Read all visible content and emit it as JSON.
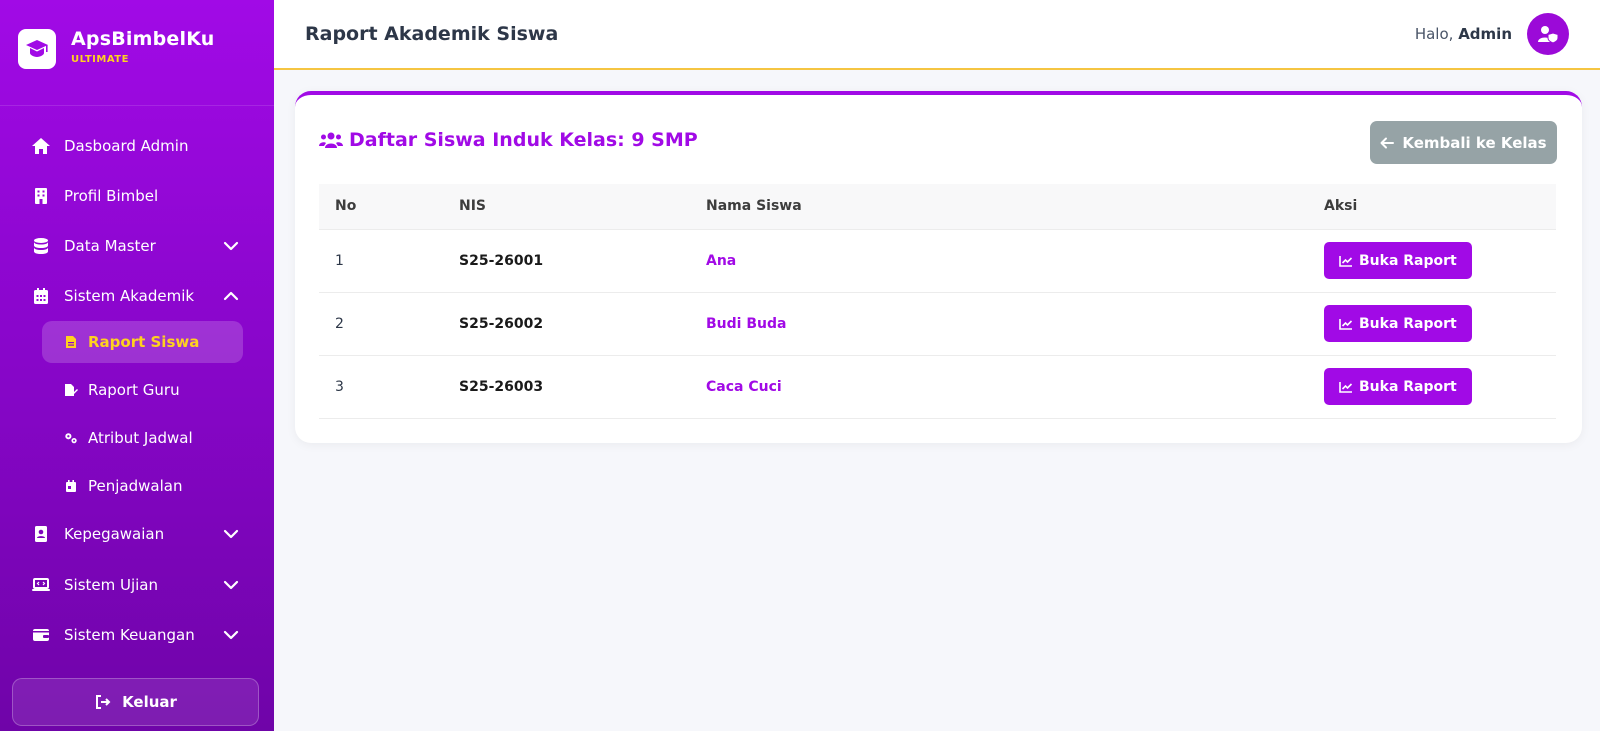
{
  "brand": {
    "name": "ApsBimbelKu",
    "subtitle": "ULTIMATE"
  },
  "sidebar": {
    "items": [
      {
        "label": "Dasboard Admin",
        "icon": "home-icon"
      },
      {
        "label": "Profil Bimbel",
        "icon": "building-icon"
      },
      {
        "label": "Data Master",
        "icon": "database-icon",
        "expanded": false
      },
      {
        "label": "Sistem Akademik",
        "icon": "calendar-icon",
        "expanded": true
      },
      {
        "label": "Kepegawaian",
        "icon": "id-card-icon",
        "expanded": false
      },
      {
        "label": "Sistem Ujian",
        "icon": "laptop-code-icon",
        "expanded": false
      },
      {
        "label": "Sistem Keuangan",
        "icon": "wallet-icon",
        "expanded": false
      }
    ],
    "subitems": [
      {
        "label": "Raport Siswa",
        "icon": "file-icon",
        "active": true
      },
      {
        "label": "Raport Guru",
        "icon": "file-signature-icon",
        "active": false
      },
      {
        "label": "Atribut Jadwal",
        "icon": "gears-icon",
        "active": false
      },
      {
        "label": "Penjadwalan",
        "icon": "calendar-day-icon",
        "active": false
      }
    ],
    "logout_label": "Keluar"
  },
  "header": {
    "title": "Raport Akademik Siswa",
    "greeting": "Halo,",
    "user": "Admin"
  },
  "card": {
    "title": "Daftar Siswa Induk Kelas: 9 SMP",
    "back_label": "Kembali ke Kelas"
  },
  "table": {
    "columns": [
      "No",
      "NIS",
      "Nama Siswa",
      "Aksi"
    ],
    "rows": [
      {
        "no": "1",
        "nis": "S25-26001",
        "name": "Ana",
        "action": "Buka Raport"
      },
      {
        "no": "2",
        "nis": "S25-26002",
        "name": "Budi Buda",
        "action": "Buka Raport"
      },
      {
        "no": "3",
        "nis": "S25-26003",
        "name": "Caca Cuci",
        "action": "Buka Raport"
      }
    ]
  },
  "colors": {
    "primary": "#a10ae6",
    "accent": "#ffd21f",
    "muted_button": "#96a3a6"
  }
}
